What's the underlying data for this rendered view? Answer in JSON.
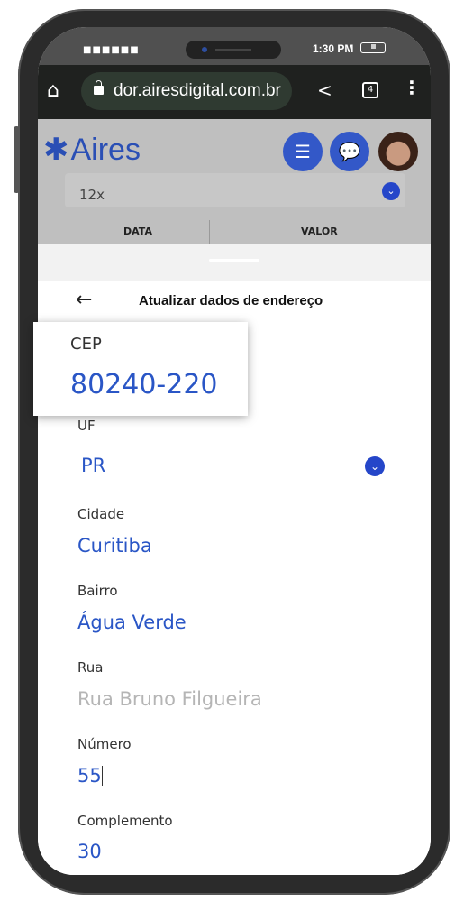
{
  "status": {
    "signal": "■■■■■■",
    "time": "1:30 PM",
    "battery": "IIIII"
  },
  "browser": {
    "url": "dor.airesdigital.com.br",
    "tab_count": "4"
  },
  "app": {
    "logo": "Aires",
    "installments": "12x",
    "table_headers": [
      "DATA",
      "VALOR"
    ]
  },
  "sheet": {
    "title": "Atualizar dados de endereço",
    "back": "←"
  },
  "form": {
    "cep": {
      "label": "CEP",
      "value": "80240-220"
    },
    "uf": {
      "label": "UF",
      "value": "PR"
    },
    "cidade": {
      "label": "Cidade",
      "value": "Curitiba"
    },
    "bairro": {
      "label": "Bairro",
      "value": "Água Verde"
    },
    "rua": {
      "label": "Rua",
      "value": "Rua Bruno Filgueira"
    },
    "numero": {
      "label": "Número",
      "value": "55"
    },
    "complemento": {
      "label": "Complemento",
      "value": "30"
    }
  },
  "colors": {
    "accent": "#2a56c6",
    "button": "#3358c8"
  }
}
